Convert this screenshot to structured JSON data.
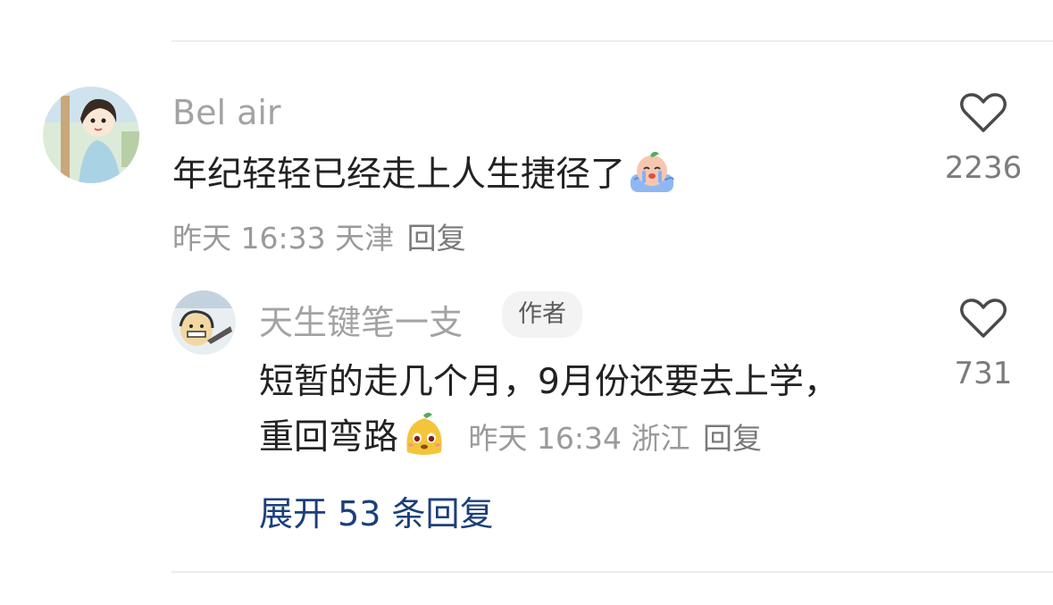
{
  "comment": {
    "username": "Bel air",
    "text": "年纪轻轻已经走上人生捷径了",
    "emoji": "crying-face-emoji",
    "time": "昨天 16:33",
    "location": "天津",
    "reply_label": "回复",
    "likes": "2236"
  },
  "reply": {
    "username": "天生键笔一支",
    "badge": "作者",
    "text_line1": "短暂的走几个月，9月份还要去上学，",
    "text_line2": "重回弯路",
    "emoji": "yellow-pudding-emoji",
    "time": "昨天 16:34",
    "location": "浙江",
    "reply_label": "回复",
    "likes": "731"
  },
  "expand_label": "展开 53 条回复",
  "colors": {
    "link": "#1b3f7a",
    "meta": "#9a9a9a",
    "username": "#a3a3a3"
  }
}
